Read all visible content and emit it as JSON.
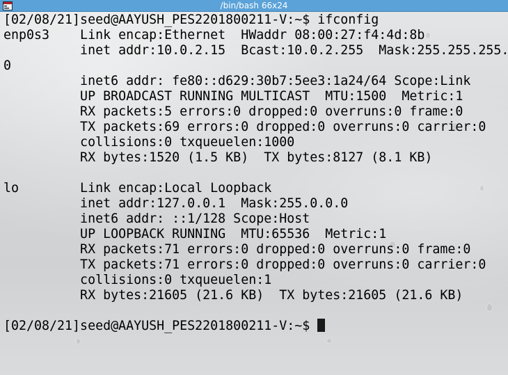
{
  "window": {
    "title": "/bin/bash 66x24"
  },
  "terminal": {
    "lines": [
      "[02/08/21]seed@AAYUSH_PES2201800211-V:~$ ifconfig",
      "enp0s3    Link encap:Ethernet  HWaddr 08:00:27:f4:4d:8b",
      "          inet addr:10.0.2.15  Bcast:10.0.2.255  Mask:255.255.255.",
      "0",
      "          inet6 addr: fe80::d629:30b7:5ee3:1a24/64 Scope:Link",
      "          UP BROADCAST RUNNING MULTICAST  MTU:1500  Metric:1",
      "          RX packets:5 errors:0 dropped:0 overruns:0 frame:0",
      "          TX packets:69 errors:0 dropped:0 overruns:0 carrier:0",
      "          collisions:0 txqueuelen:1000",
      "          RX bytes:1520 (1.5 KB)  TX bytes:8127 (8.1 KB)",
      "",
      "lo        Link encap:Local Loopback",
      "          inet addr:127.0.0.1  Mask:255.0.0.0",
      "          inet6 addr: ::1/128 Scope:Host",
      "          UP LOOPBACK RUNNING  MTU:65536  Metric:1",
      "          RX packets:71 errors:0 dropped:0 overruns:0 frame:0",
      "          TX packets:71 errors:0 dropped:0 overruns:0 carrier:0",
      "          collisions:0 txqueuelen:1",
      "          RX bytes:21605 (21.6 KB)  TX bytes:21605 (21.6 KB)",
      "",
      "[02/08/21]seed@AAYUSH_PES2201800211-V:~$ "
    ]
  },
  "colors": {
    "titlebar": "#5aa2d8",
    "text": "#000000",
    "cursor": "#1a1a1a"
  },
  "icons": {
    "app": "terminal-app-icon"
  }
}
